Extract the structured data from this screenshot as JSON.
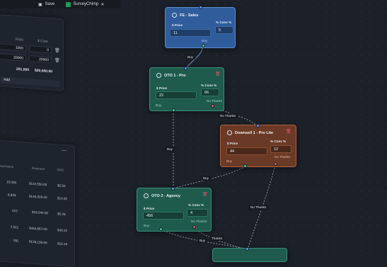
{
  "topbar": {
    "save_label": "Save",
    "doc_name": "SurveyChimp"
  },
  "revenue_panel": {
    "headers": [
      "Visits",
      "$ Cost"
    ],
    "rows": [
      {
        "visits": "1000",
        "cost": "0"
      },
      {
        "visits": "20000",
        "cost": "20000"
      }
    ],
    "totals": {
      "visits": "201,000",
      "cost": "$20,000.00"
    },
    "add_label": "Add"
  },
  "metrics_panel": {
    "headers": [
      "onversions",
      "Revenue",
      "EPC"
    ],
    "rows": [
      [
        "10,050",
        "$110,550.00",
        "$0.55"
      ],
      [
        "6,633",
        "$145,926.00",
        "$14.92"
      ],
      [
        "410",
        "$18,040.00",
        "$5.28"
      ],
      [
        "2,511",
        "$464,667.00",
        "$49.22"
      ],
      [
        "281",
        "$128,136.00",
        "$18.19"
      ]
    ]
  },
  "nodes": {
    "fe": {
      "title": "FE - Sales",
      "price_label": "$ Price",
      "price": "11",
      "conv_label": "% Conv %",
      "conv": "5",
      "buy": "Buy"
    },
    "oto1": {
      "title": "OTO 1 - Pro",
      "price_label": "$ Price",
      "price": "22",
      "conv_label": "% Conv %",
      "conv": "66",
      "buy": "Buy",
      "no": "No Thanks"
    },
    "downsell": {
      "title": "Downsell 1 - Pro Lite",
      "price_label": "$ Price",
      "price": "44",
      "conv_label": "% Conv %",
      "conv": "12",
      "buy": "Buy",
      "no": "No Thanks"
    },
    "oto2": {
      "title": "OTO 2 - Agency",
      "price_label": "$ Price",
      "price": "456",
      "conv_label": "% Conv %",
      "conv": "4",
      "buy": "Buy",
      "no": "No Thanks"
    }
  },
  "edge_labels": {
    "fe_buy": "Buy",
    "oto1_no": "No Thanks",
    "oto1_buy": "Buy",
    "down_buy": "Buy",
    "down_no": "No Thanks",
    "oto2_buy": "Buy",
    "oto2_no": "Thanks"
  },
  "colors": {
    "background": "#1b2029",
    "blue": "#2f5d9c",
    "green": "#1f5b4d",
    "orange": "#6b3a26"
  }
}
